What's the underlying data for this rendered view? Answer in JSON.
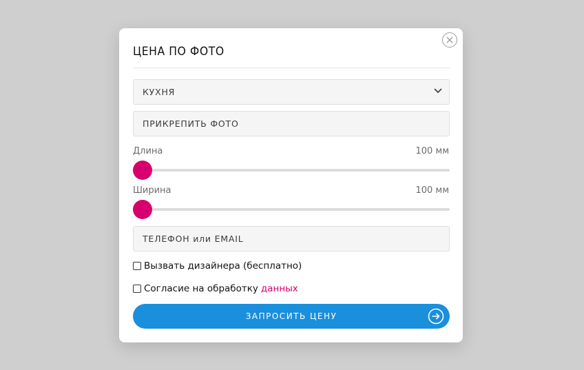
{
  "modal": {
    "title": "ЦЕНА ПО ФОТО"
  },
  "form": {
    "room_select": {
      "value": "КУХНЯ",
      "icon": "chevron-down-icon"
    },
    "photo_button_label": "ПРИКРЕПИТЬ ФОТО",
    "sliders": [
      {
        "label": "Длина",
        "value": "100 мм",
        "level": 0
      },
      {
        "label": "Ширина",
        "value": "100 мм",
        "level": 0
      }
    ],
    "contact_placeholder": "ТЕЛЕФОН или EMAIL",
    "checkboxes": [
      {
        "label": "Вызвать дизайнера (бесплатно)",
        "checked": false
      },
      {
        "label": "Согласие на обработку",
        "link": "данных",
        "checked": false
      }
    ],
    "submit_label": "ЗАПРОСИТЬ ЦЕНУ"
  },
  "colors": {
    "accent": "#d6006e",
    "button": "#1a8fdc",
    "backdrop": "#cfcfcf"
  }
}
